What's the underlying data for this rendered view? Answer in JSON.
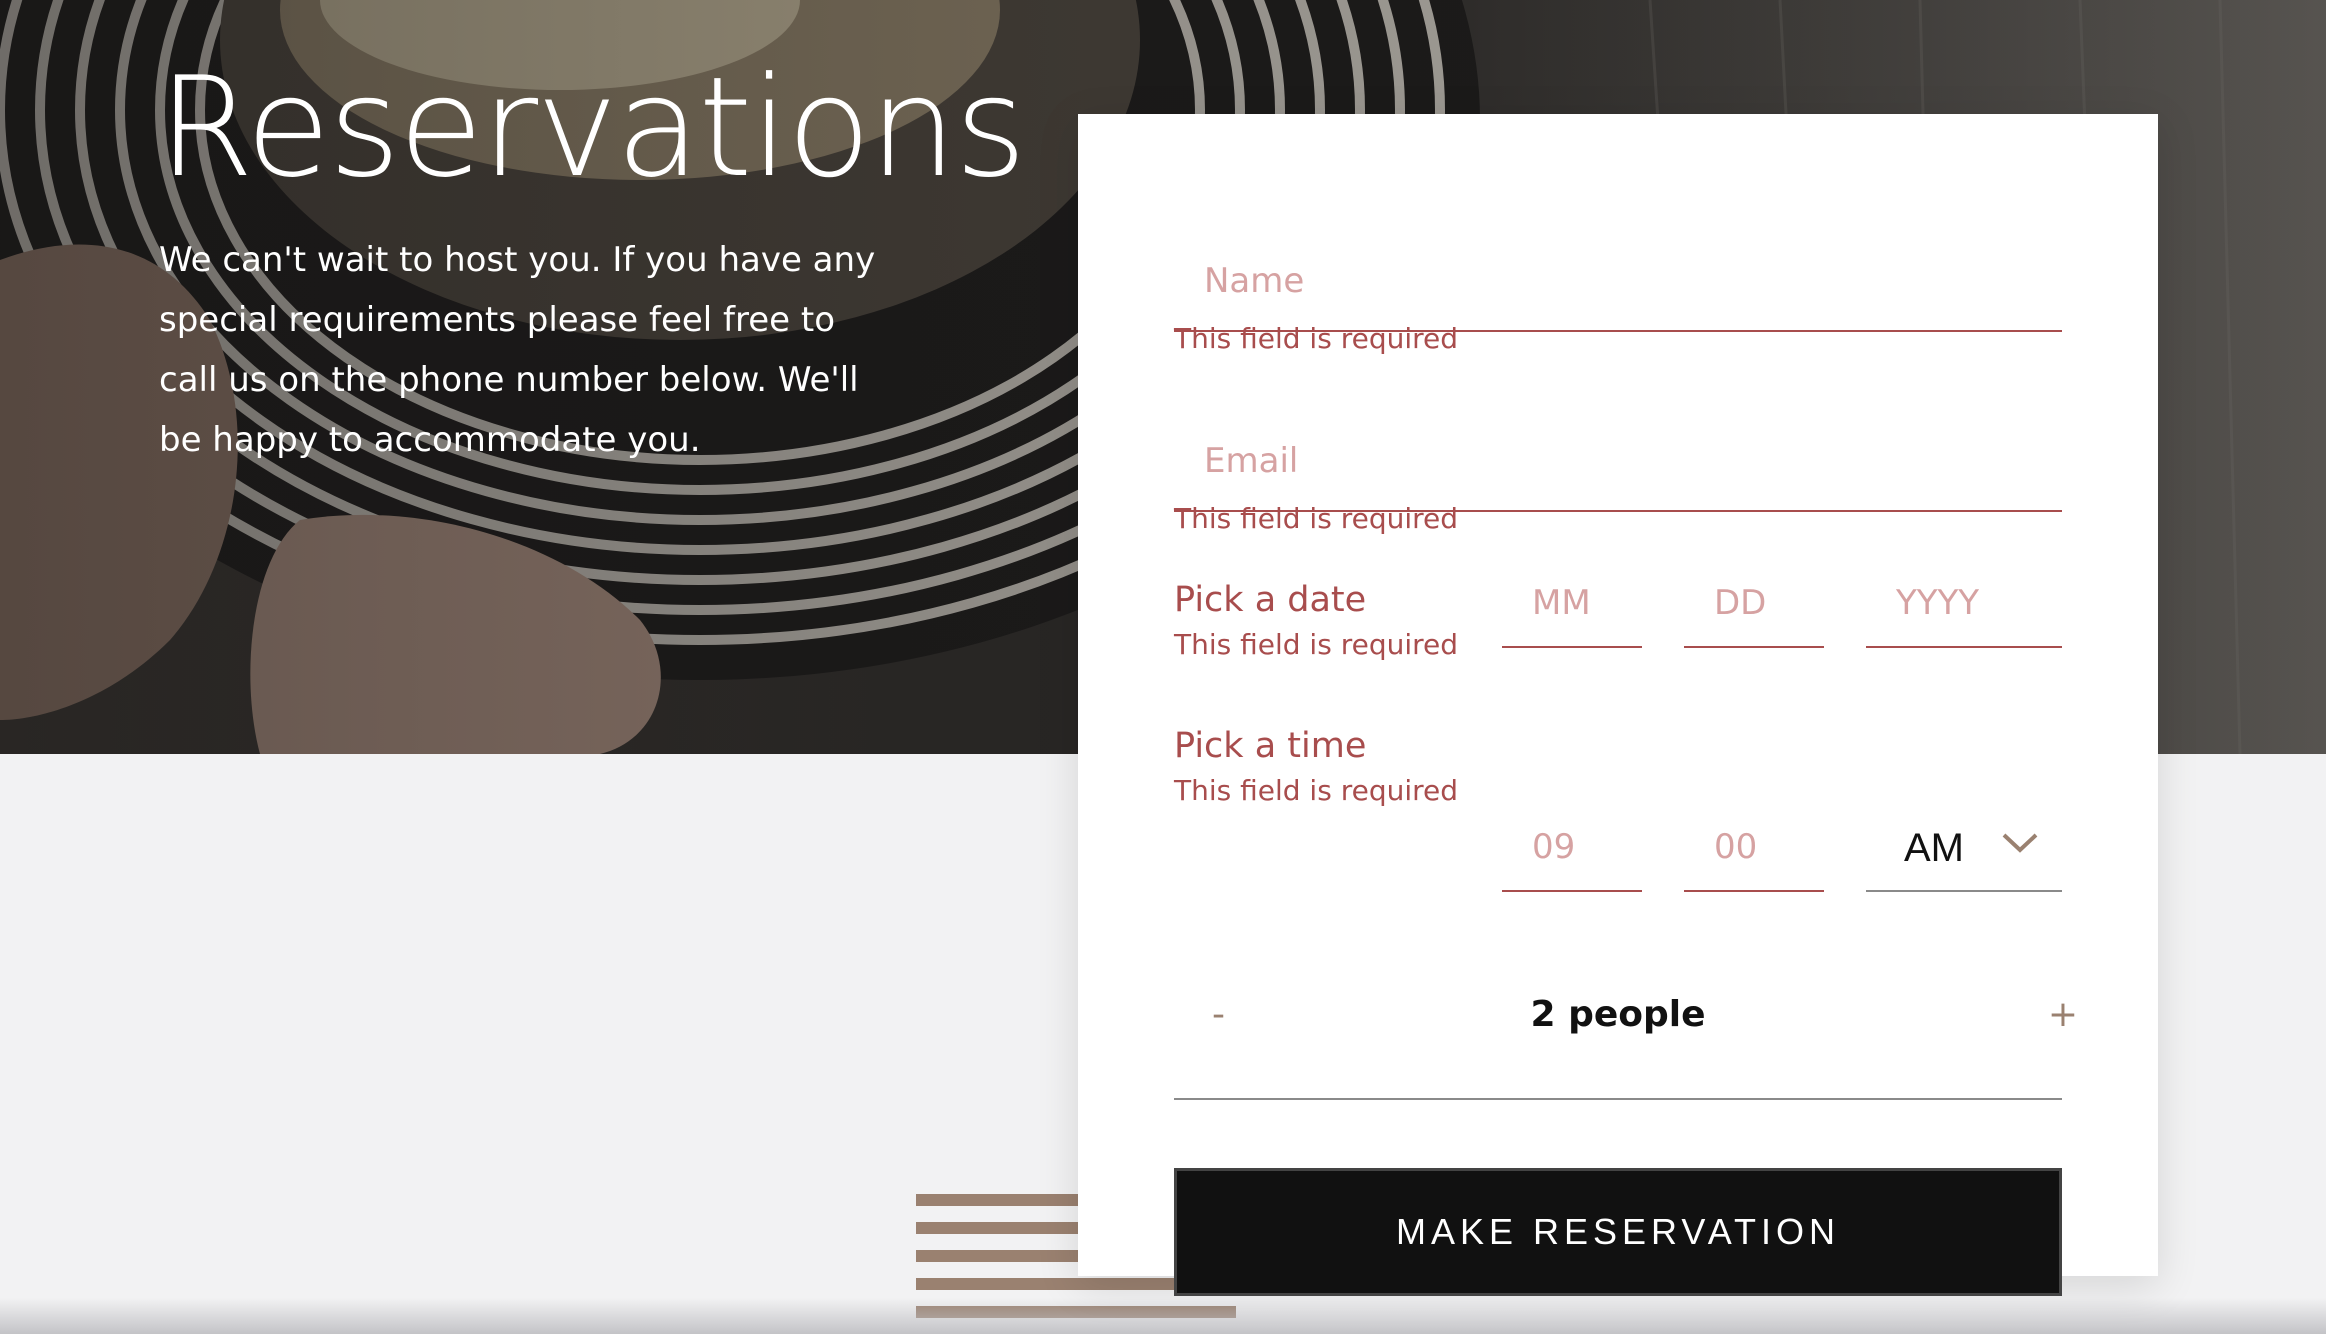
{
  "page": {
    "title": "Reservations",
    "intro": "We can't wait to host you. If you have any special requirements please feel free to call us on the phone number below. We'll be happy to accommodate you."
  },
  "form": {
    "name": {
      "placeholder": "Name",
      "value": "",
      "error": "This field is required"
    },
    "email": {
      "placeholder": "Email",
      "value": "",
      "error": "This field is required"
    },
    "date": {
      "label": "Pick a date",
      "error": "This field is required",
      "month_placeholder": "MM",
      "day_placeholder": "DD",
      "year_placeholder": "YYYY"
    },
    "time": {
      "label": "Pick a time",
      "error": "This field is required",
      "hour_placeholder": "09",
      "minute_placeholder": "00",
      "period": "AM"
    },
    "party": {
      "decrement": "-",
      "count_label": "2 people",
      "increment": "+"
    },
    "submit_label": "MAKE RESERVATION"
  },
  "colors": {
    "error": "#a84d4d",
    "accent": "#9a8170",
    "button": "#111111"
  }
}
